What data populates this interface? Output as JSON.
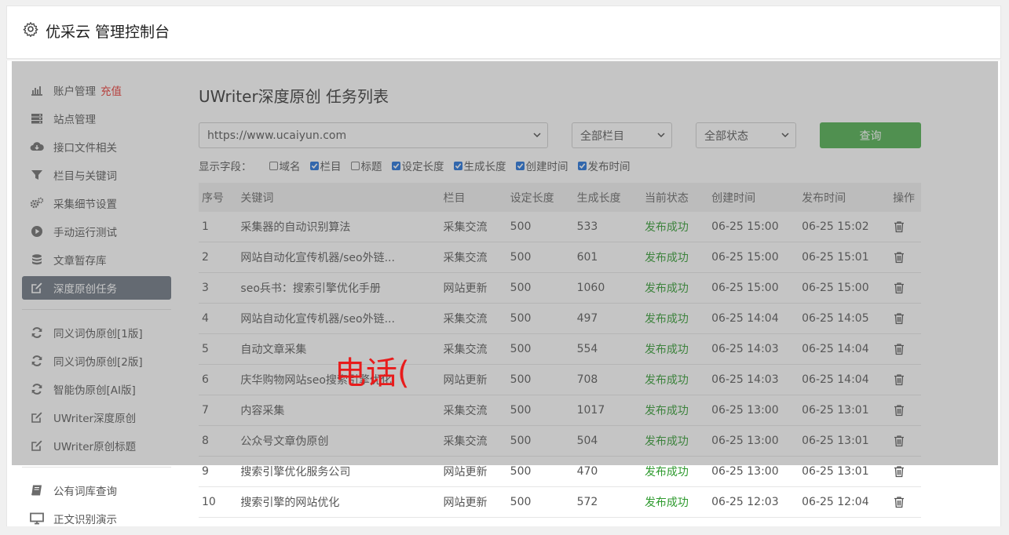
{
  "header": {
    "title": "优采云 管理控制台"
  },
  "sidebar": {
    "group1": [
      {
        "label": "账户管理",
        "badge": "充值",
        "icon": "bar-chart-icon"
      },
      {
        "label": "站点管理",
        "icon": "server-icon"
      },
      {
        "label": "接口文件相关",
        "icon": "cloud-download-icon"
      },
      {
        "label": "栏目与关键词",
        "icon": "filter-icon"
      },
      {
        "label": "采集细节设置",
        "icon": "gears-icon"
      },
      {
        "label": "手动运行测试",
        "icon": "play-circle-icon"
      },
      {
        "label": "文章暂存库",
        "icon": "database-icon"
      },
      {
        "label": "深度原创任务",
        "icon": "edit-icon",
        "active": true
      }
    ],
    "group2": [
      {
        "label": "同义词伪原创[1版]",
        "icon": "refresh-icon"
      },
      {
        "label": "同义词伪原创[2版]",
        "icon": "refresh-icon"
      },
      {
        "label": "智能伪原创[AI版]",
        "icon": "refresh-icon"
      },
      {
        "label": "UWriter深度原创",
        "icon": "edit-icon"
      },
      {
        "label": "UWriter原创标题",
        "icon": "edit-icon"
      }
    ],
    "group3": [
      {
        "label": "公有词库查询",
        "icon": "book-icon"
      },
      {
        "label": "正文识别演示",
        "icon": "monitor-icon"
      }
    ]
  },
  "main": {
    "title": "UWriter深度原创 任务列表",
    "filters": {
      "site": "https://www.ucaiyun.com",
      "column": "全部栏目",
      "status": "全部状态",
      "query_label": "查询"
    },
    "fields_label": "显示字段：",
    "fields": [
      {
        "label": "域名",
        "checked": false
      },
      {
        "label": "栏目",
        "checked": true
      },
      {
        "label": "标题",
        "checked": false
      },
      {
        "label": "设定长度",
        "checked": true
      },
      {
        "label": "生成长度",
        "checked": true
      },
      {
        "label": "创建时间",
        "checked": true
      },
      {
        "label": "发布时间",
        "checked": true
      }
    ],
    "columns": [
      "序号",
      "关键词",
      "栏目",
      "设定长度",
      "生成长度",
      "当前状态",
      "创建时间",
      "发布时间",
      "操作"
    ],
    "rows": [
      [
        "1",
        "采集器的自动识别算法",
        "采集交流",
        "500",
        "533",
        "发布成功",
        "06-25 15:00",
        "06-25 15:02"
      ],
      [
        "2",
        "网站自动化宣传机器/seo外链...",
        "采集交流",
        "500",
        "601",
        "发布成功",
        "06-25 15:00",
        "06-25 15:01"
      ],
      [
        "3",
        "seo兵书：搜索引擎优化手册",
        "网站更新",
        "500",
        "1060",
        "发布成功",
        "06-25 15:00",
        "06-25 15:00"
      ],
      [
        "4",
        "网站自动化宣传机器/seo外链...",
        "采集交流",
        "500",
        "497",
        "发布成功",
        "06-25 14:04",
        "06-25 14:05"
      ],
      [
        "5",
        "自动文章采集",
        "采集交流",
        "500",
        "554",
        "发布成功",
        "06-25 14:03",
        "06-25 14:04"
      ],
      [
        "6",
        "庆华购物网站seo搜索引擎优化",
        "网站更新",
        "500",
        "708",
        "发布成功",
        "06-25 14:03",
        "06-25 14:04"
      ],
      [
        "7",
        "内容采集",
        "采集交流",
        "500",
        "1017",
        "发布成功",
        "06-25 13:00",
        "06-25 13:01"
      ],
      [
        "8",
        "公众号文章伪原创",
        "采集交流",
        "500",
        "504",
        "发布成功",
        "06-25 13:00",
        "06-25 13:01"
      ],
      [
        "9",
        "搜索引擎优化服务公司",
        "网站更新",
        "500",
        "470",
        "发布成功",
        "06-25 13:00",
        "06-25 13:01"
      ],
      [
        "10",
        "搜索引擎的网站优化",
        "网站更新",
        "500",
        "572",
        "发布成功",
        "06-25 12:03",
        "06-25 12:04"
      ]
    ]
  },
  "overlay_text": "电话(",
  "colors": {
    "active_nav": "#6b7480",
    "query_button": "#4cae4c",
    "success": "#2e9a2e",
    "recharge": "#e8342f",
    "overlay_text": "#e81c1c"
  }
}
